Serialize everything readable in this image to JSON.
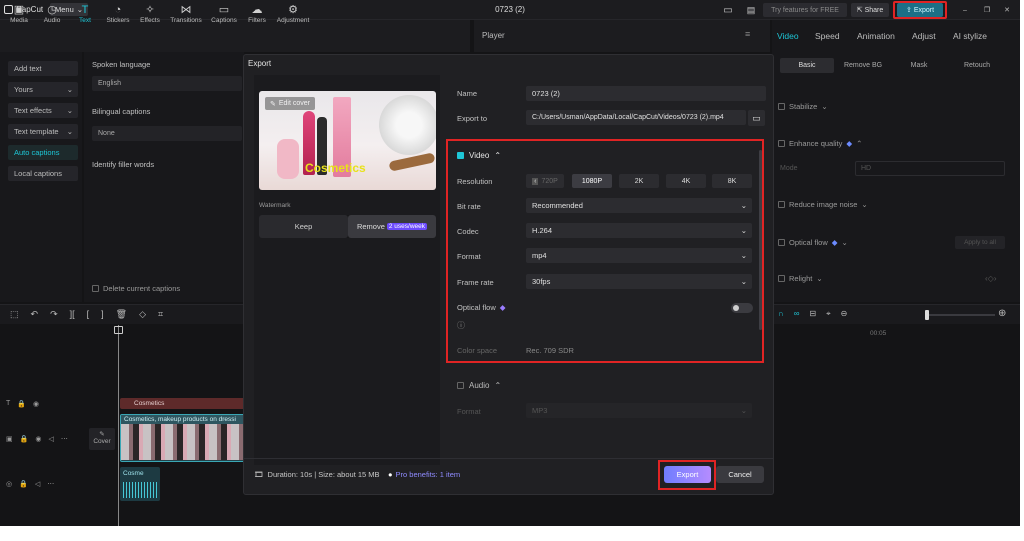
{
  "app": {
    "name": "CapCut",
    "menu_label": "Menu",
    "project_title": "0723 (2)"
  },
  "titlebar": {
    "pro_label": "Try features for FREE",
    "share_label": "Share",
    "export_label": "Export"
  },
  "toolbar": [
    {
      "label": "Media",
      "icon": "media-icon"
    },
    {
      "label": "Audio",
      "icon": "audio-icon"
    },
    {
      "label": "Text",
      "icon": "text-icon",
      "active": true
    },
    {
      "label": "Stickers",
      "icon": "stickers-icon"
    },
    {
      "label": "Effects",
      "icon": "effects-icon"
    },
    {
      "label": "Transitions",
      "icon": "transitions-icon"
    },
    {
      "label": "Captions",
      "icon": "captions-icon"
    },
    {
      "label": "Filters",
      "icon": "filters-icon"
    },
    {
      "label": "Adjustment",
      "icon": "adjustment-icon"
    }
  ],
  "left_panel": [
    "Add text",
    "Yours",
    "Text effects",
    "Text template",
    "Auto captions",
    "Local captions"
  ],
  "captions_panel": {
    "spoken_language_label": "Spoken language",
    "spoken_language_value": "English",
    "bilingual_label": "Bilingual captions",
    "bilingual_value": "None",
    "filler_label": "Identify filler words",
    "delete_label": "Delete current captions"
  },
  "player": {
    "title": "Player"
  },
  "right_panel": {
    "tabs": [
      "Video",
      "Speed",
      "Animation",
      "Adjust",
      "AI stylize"
    ],
    "subtabs": [
      "Basic",
      "Remove BG",
      "Mask",
      "Retouch"
    ],
    "rows": [
      "Stabilize",
      "Enhance quality",
      "Reduce image noise",
      "Optical flow",
      "Relight"
    ],
    "quality_label": "Mode",
    "quality_value": "HD",
    "apply_label": "Apply to all"
  },
  "timeline": {
    "time_label": "00:05",
    "text_clip": "Cosmetics",
    "video_clip": "Cosmetics, makeup products on dressi",
    "audio_clip": "Cosme",
    "cover_label": "Cover"
  },
  "dialog": {
    "title": "Export",
    "edit_cover": "Edit cover",
    "thumbnail_text": "Cosmetics",
    "watermark_label": "Watermark",
    "keep_label": "Keep",
    "remove_label": "Remove",
    "remove_badge": "2 uses/week",
    "name_label": "Name",
    "name_value": "0723 (2)",
    "export_to_label": "Export to",
    "export_to_value": "C:/Users/Usman/AppData/Local/CapCut/Videos/0723 (2).mp4",
    "video_section": "Video",
    "resolution_label": "Resolution",
    "resolutions": [
      "720P",
      "1080P",
      "2K",
      "4K",
      "8K"
    ],
    "bitrate_label": "Bit rate",
    "bitrate_value": "Recommended",
    "codec_label": "Codec",
    "codec_value": "H.264",
    "format_label": "Format",
    "format_value": "mp4",
    "framerate_label": "Frame rate",
    "framerate_value": "30fps",
    "optical_flow_label": "Optical flow",
    "colorspace_label": "Color space",
    "colorspace_value": "Rec. 709 SDR",
    "audio_section": "Audio",
    "audio_format_label": "Format",
    "audio_format_value": "MP3",
    "footer_info": "Duration: 10s | Size: about 15 MB",
    "pro_benefits": "Pro benefits: 1 item",
    "export_button": "Export",
    "cancel_button": "Cancel"
  },
  "colors": {
    "accent": "#1ec6d6",
    "highlight": "#e02424",
    "pro": "#6c4bff"
  }
}
